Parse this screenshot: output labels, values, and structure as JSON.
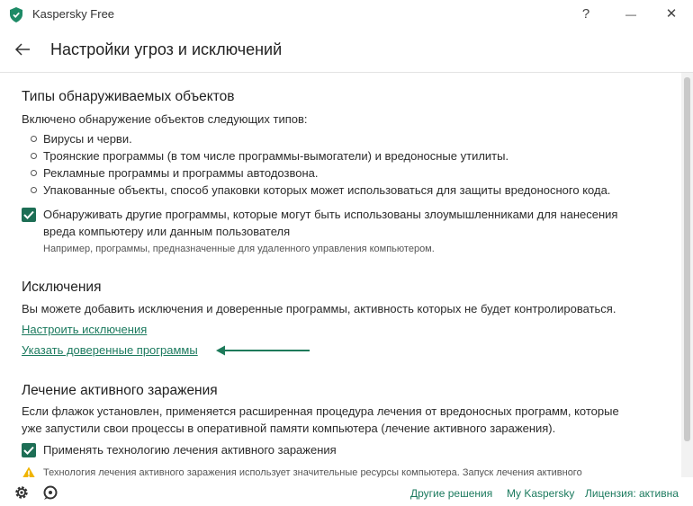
{
  "window": {
    "title": "Kaspersky Free",
    "help": "?",
    "minimize": "—",
    "close": "✕"
  },
  "header": {
    "title": "Настройки угроз и исключений"
  },
  "detection": {
    "title": "Типы обнаруживаемых объектов",
    "intro": "Включено обнаружение объектов следующих типов:",
    "items": [
      "Вирусы и черви.",
      "Троянские программы (в том числе программы-вымогатели) и вредоносные утилиты.",
      "Рекламные программы и программы автодозвона.",
      "Упакованные объекты, способ упаковки которых может использоваться для защиты вредоносного кода."
    ],
    "checkbox_line1": "Обнаруживать другие программы, которые могут быть использованы злоумышленниками для нанесения",
    "checkbox_line2": "вреда компьютеру или данным пользователя",
    "checkbox_note": "Например, программы, предназначенные для удаленного управления компьютером."
  },
  "exclusions": {
    "title": "Исключения",
    "desc": "Вы можете добавить исключения и доверенные программы, активность которых не будет контролироваться.",
    "link_exclusions": "Настроить исключения",
    "link_trusted": "Указать доверенные программы"
  },
  "disinfection": {
    "title": "Лечение активного заражения",
    "desc_line1": "Если флажок установлен, применяется расширенная процедура лечения от вредоносных программ, которые",
    "desc_line2": "уже запустили свои процессы в оперативной памяти компьютера (лечение активного заражения).",
    "checkbox_label": "Применять технологию лечения активного заражения",
    "warning": "Технология лечения активного заражения использует значительные ресурсы компьютера. Запуск лечения активного"
  },
  "footer": {
    "link_other": "Другие решения",
    "link_my": "My Kaspersky",
    "license": "Лицензия: активна"
  },
  "colors": {
    "accent": "#1b7a5e",
    "checkbox": "#1d6e55",
    "warning": "#f0b400"
  },
  "icons": {
    "settings": "gear-icon",
    "support": "support-icon",
    "logo": "kaspersky-shield-icon"
  }
}
